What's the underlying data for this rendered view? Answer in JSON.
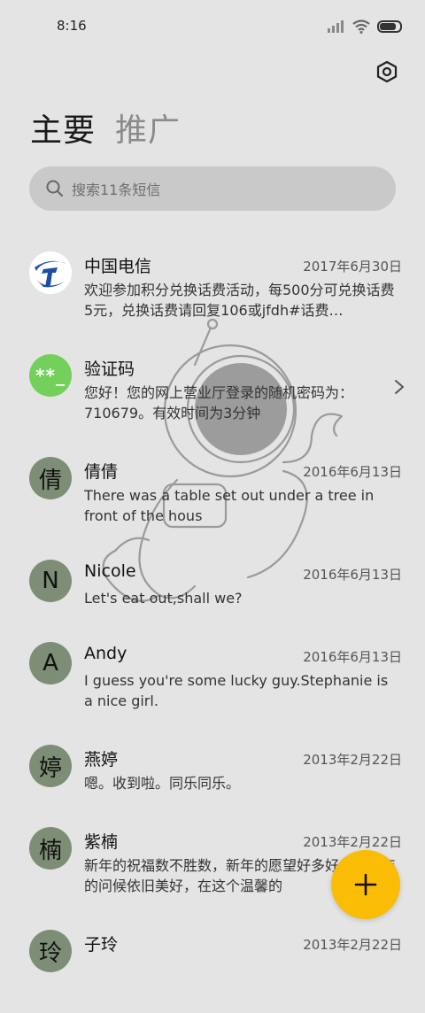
{
  "status_bar": {
    "time": "8:16",
    "battery_level": 0.9
  },
  "header": {
    "tabs": [
      {
        "label": "主要",
        "active": true
      },
      {
        "label": "推广",
        "active": false
      }
    ]
  },
  "search": {
    "placeholder": "搜索11条短信"
  },
  "conversations": [
    {
      "name": "中国电信",
      "date": "2017年6月30日",
      "preview": "欢迎参加积分兑换话费活动，每500分可兑换话费5元，兑换话费请回复106或jfdh#话费…",
      "avatar": "telecom-logo"
    },
    {
      "name": "验证码",
      "date": "",
      "preview": "您好！您的网上营业厅登录的随机密码为：710679。有效时间为3分钟",
      "avatar_text": "**_"
    },
    {
      "name": "倩倩",
      "date": "2016年6月13日",
      "preview": "There was a table set out under a tree in front of the hous",
      "avatar_text": "倩"
    },
    {
      "name": "Nicole",
      "date": "2016年6月13日",
      "preview": "Let's eat out,shall we?",
      "avatar_text": "N"
    },
    {
      "name": "Andy",
      "date": "2016年6月13日",
      "preview": "I guess you're some lucky guy.Stephanie is a nice girl.",
      "avatar_text": "A"
    },
    {
      "name": "燕婷",
      "date": "2013年2月22日",
      "preview": "嗯。收到啦。同乐同乐。",
      "avatar_text": "婷"
    },
    {
      "name": "紫楠",
      "date": "2013年2月22日",
      "preview": "新年的祝福数不胜数，新年的愿望好多好多，新年的问候依旧美好，在这个温馨的",
      "avatar_text": "楠"
    },
    {
      "name": "子玲",
      "date": "2013年2月22日",
      "preview": "",
      "avatar_text": "玲"
    }
  ],
  "colors": {
    "background": "#e4e4e4",
    "avatar": "#7e8d76",
    "verify_avatar": "#73d05a",
    "fab": "#fbbc05",
    "search_bg": "#c9c9c9"
  },
  "icons": [
    "signal-icon",
    "wifi-icon",
    "battery-icon",
    "settings-icon",
    "search-icon",
    "chevron-right-icon",
    "plus-icon"
  ]
}
